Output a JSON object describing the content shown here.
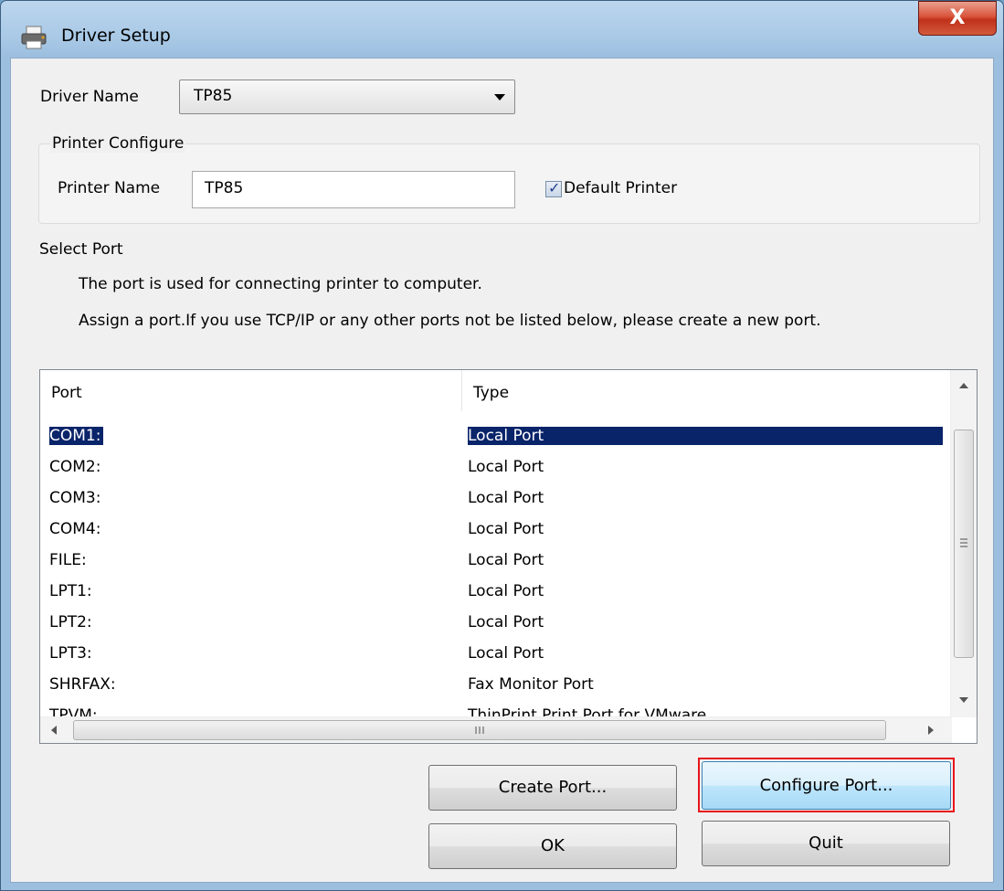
{
  "window": {
    "title": "Driver Setup",
    "close_glyph": "X"
  },
  "driver": {
    "label": "Driver Name",
    "value": "TP85"
  },
  "printer_configure": {
    "group_label": "Printer Configure",
    "name_label": "Printer Name",
    "name_value": "TP85",
    "default_label": "Default Printer",
    "default_checked": true
  },
  "select_port": {
    "heading": "Select Port",
    "desc1": "The port is used for connecting printer to computer.",
    "desc2": "Assign a port.If you use TCP/IP or any other ports not be listed below, please create a new port."
  },
  "port_list": {
    "columns": [
      "Port",
      "Type"
    ],
    "rows": [
      {
        "port": "COM1:",
        "type": "Local Port",
        "selected": true
      },
      {
        "port": "COM2:",
        "type": "Local Port"
      },
      {
        "port": "COM3:",
        "type": "Local Port"
      },
      {
        "port": "COM4:",
        "type": "Local Port"
      },
      {
        "port": "FILE:",
        "type": "Local Port"
      },
      {
        "port": "LPT1:",
        "type": "Local Port"
      },
      {
        "port": "LPT2:",
        "type": "Local Port"
      },
      {
        "port": "LPT3:",
        "type": "Local Port"
      },
      {
        "port": "SHRFAX:",
        "type": "Fax Monitor Port"
      },
      {
        "port": "TPVM:",
        "type": "ThinPrint Print Port for VMware"
      }
    ]
  },
  "buttons": {
    "create_port": "Create Port...",
    "configure_port": "Configure Port...",
    "ok": "OK",
    "quit": "Quit"
  },
  "icons": [
    "printer-icon",
    "close-icon",
    "dropdown-arrow-icon",
    "checkmark-icon",
    "scroll-up-icon",
    "scroll-down-icon",
    "scroll-left-icon",
    "scroll-right-icon",
    "grip-icon"
  ],
  "colors": {
    "selection": "#0a246a",
    "highlight_border": "#e8141c",
    "close_button": "#c0311b"
  }
}
